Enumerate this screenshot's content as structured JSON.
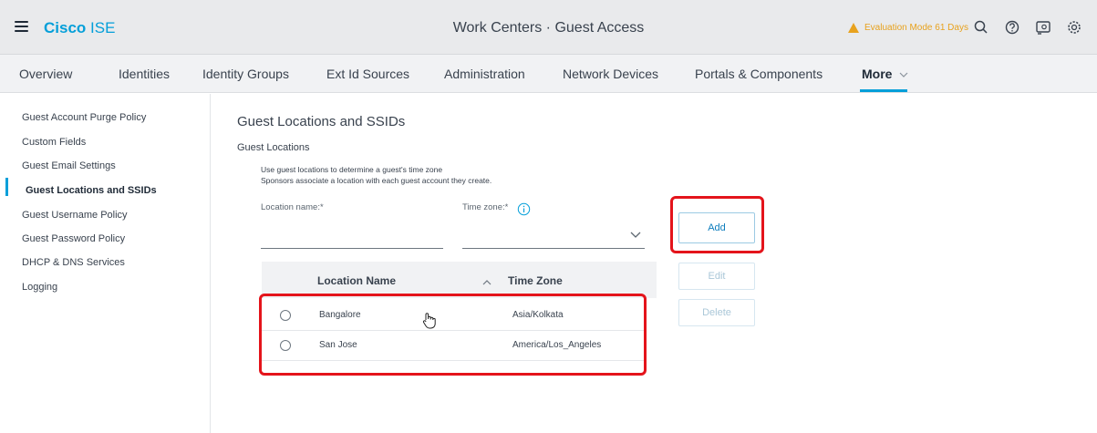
{
  "header": {
    "brand_bold": "Cisco",
    "brand_light": "ISE",
    "title": "Work Centers · Guest Access",
    "evaluation": "Evaluation Mode 61 Days",
    "icons": [
      "search-icon",
      "help-icon",
      "notifications-icon",
      "settings-icon"
    ]
  },
  "nav": {
    "tabs": [
      "Overview",
      "Identities",
      "Identity Groups",
      "Ext Id Sources",
      "Administration",
      "Network Devices",
      "Portals & Components"
    ],
    "more_label": "More"
  },
  "sidebar": {
    "items": [
      "Guest Account Purge Policy",
      "Custom Fields",
      "Guest Email Settings",
      "Guest Locations and SSIDs",
      "Guest Username Policy",
      "Guest Password Policy",
      "DHCP & DNS Services",
      "Logging"
    ],
    "active_index": 3
  },
  "main": {
    "title": "Guest Locations and SSIDs",
    "section": "Guest Locations",
    "desc_line1": "Use guest locations to determine a guest's time zone",
    "desc_line2": "Sponsors associate a location with each guest account they create.",
    "location_label": "Location name:*",
    "location_value": "",
    "timezone_label": "Time zone:*",
    "timezone_value": "",
    "add_label": "Add",
    "edit_label": "Edit",
    "delete_label": "Delete"
  },
  "table": {
    "columns": [
      "Location Name",
      "Time Zone"
    ],
    "rows": [
      {
        "location": "Bangalore",
        "timezone": "Asia/Kolkata"
      },
      {
        "location": "San Jose",
        "timezone": "America/Los_Angeles"
      }
    ]
  },
  "colors": {
    "accent": "#049fd9",
    "highlight": "#e4141b",
    "warning": "#e8a21e"
  }
}
